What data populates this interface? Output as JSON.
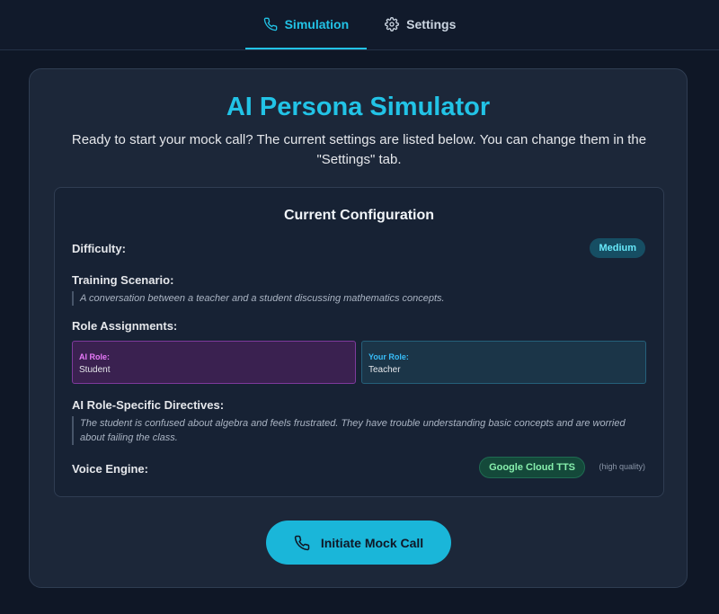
{
  "tabs": [
    {
      "label": "Simulation",
      "icon": "phone-icon",
      "active": true
    },
    {
      "label": "Settings",
      "icon": "gear-icon",
      "active": false
    }
  ],
  "main": {
    "title": "AI Persona Simulator",
    "subtitle": "Ready to start your mock call? The current settings are listed below. You can change them in the \"Settings\" tab."
  },
  "config": {
    "title": "Current Configuration",
    "difficulty_label": "Difficulty:",
    "difficulty_value": "Medium",
    "scenario_label": "Training Scenario:",
    "scenario_value": "A conversation between a teacher and a student discussing mathematics concepts.",
    "roles_label": "Role Assignments:",
    "ai_role_key": "AI Role:",
    "ai_role_value": "Student",
    "your_role_key": "Your Role:",
    "your_role_value": "Teacher",
    "directives_label": "AI Role-Specific Directives:",
    "directives_value": "The student is confused about algebra and feels frustrated. They have trouble understanding basic concepts and are worried about failing the class.",
    "voice_label": "Voice Engine:",
    "voice_value": "Google Cloud TTS",
    "voice_note": "(high quality)"
  },
  "cta": {
    "label": "Initiate Mock Call",
    "icon": "phone-icon"
  },
  "colors": {
    "accent": "#22c3e6",
    "background": "#0f1726",
    "card": "#1c2739"
  }
}
